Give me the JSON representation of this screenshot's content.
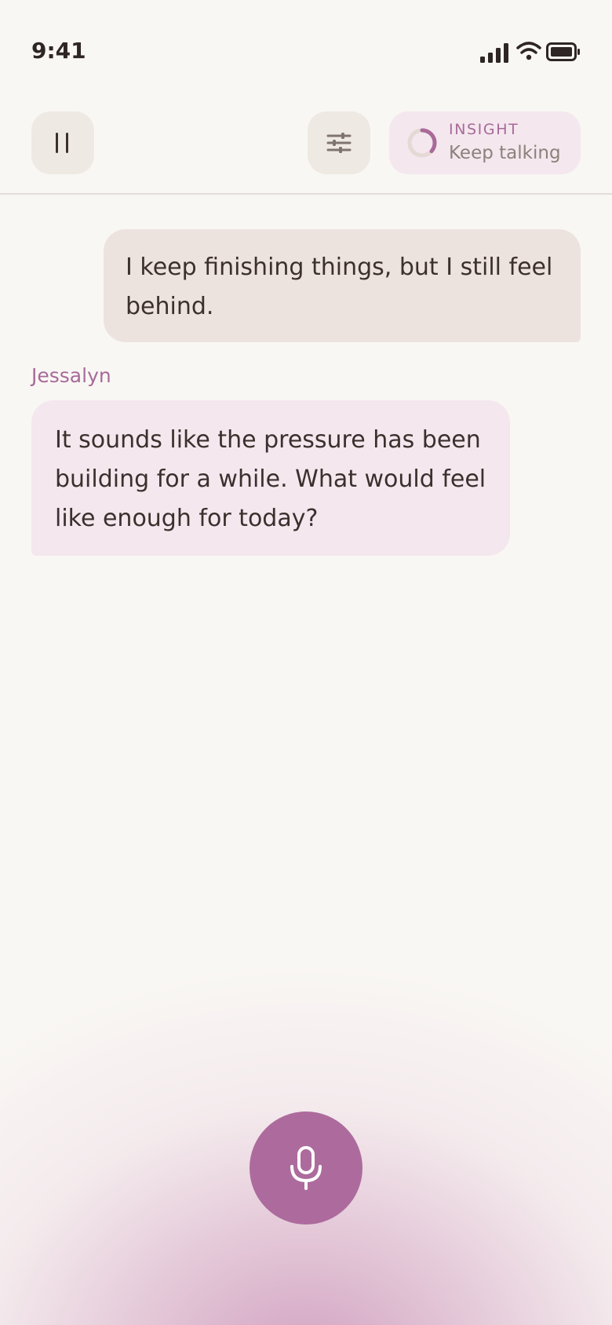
{
  "status_bar": {
    "time": "9:41"
  },
  "header": {
    "pause_icon": "pause-icon",
    "settings_icon": "sliders-icon",
    "insight": {
      "label": "INSIGHT",
      "status": "Keep talking"
    }
  },
  "conversation": {
    "messages": [
      {
        "role": "user",
        "text": "I keep finishing things, but I still feel behind."
      },
      {
        "role": "assistant",
        "speaker": "Jessalyn",
        "text": "It sounds like the pressure has been building for a while. What would feel like enough for today?"
      }
    ]
  },
  "mic": {
    "icon": "microphone-icon"
  },
  "colors": {
    "accent": "#ad6b9d",
    "background": "#f9f7f4",
    "user_bubble": "#ede3de",
    "assistant_bubble": "#f4e7ee"
  }
}
